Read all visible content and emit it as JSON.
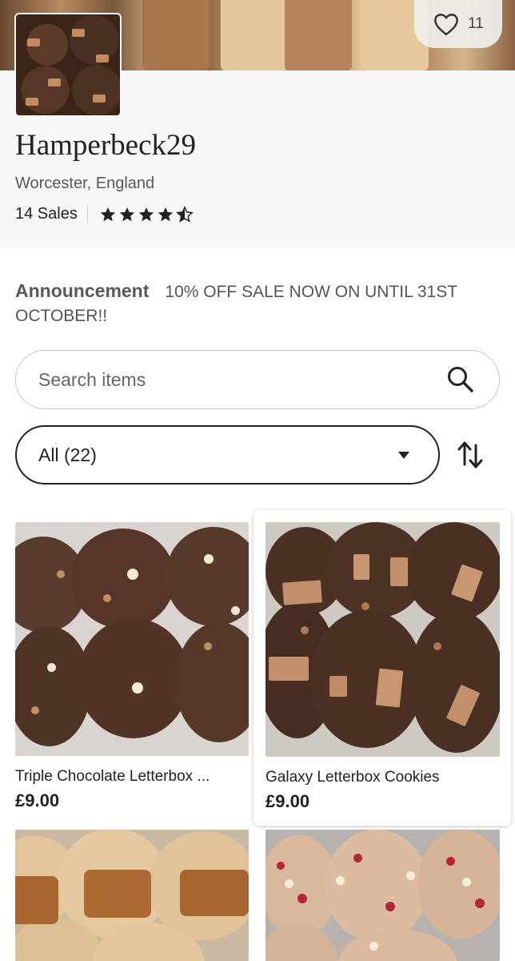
{
  "shop": {
    "name": "Hamperbeck29",
    "location": "Worcester, England",
    "sales": "14 Sales",
    "rating": 4.5,
    "favorites_count": "11"
  },
  "announcement": {
    "label": "Announcement",
    "text": "10% OFF SALE NOW ON UNTIL 31ST OCTOBER!!"
  },
  "search": {
    "placeholder": "Search items"
  },
  "filter": {
    "selected": "All (22)"
  },
  "listings": [
    {
      "title": "Triple Chocolate Letterbox ...",
      "price": "£9.00"
    },
    {
      "title": "Galaxy Letterbox Cookies",
      "price": "£9.00"
    },
    {
      "title": "",
      "price": ""
    },
    {
      "title": "",
      "price": ""
    }
  ],
  "icons": {
    "favorite": "heart-icon",
    "search": "search-icon",
    "dropdown": "caret-down-icon",
    "sort": "sort-arrows-icon",
    "rating": "star-icon"
  },
  "colors": {
    "text": "#222222",
    "muted": "#595959",
    "header_bg": "#f7f7f7",
    "border": "#c7c7c7"
  }
}
